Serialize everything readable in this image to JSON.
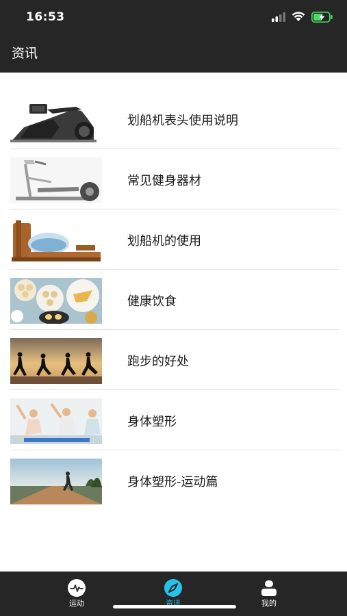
{
  "status_bar": {
    "time": "16:53"
  },
  "header": {
    "title": "资讯"
  },
  "articles": [
    {
      "title": "划船机表头使用说明",
      "thumbnail": "rowing-machine-monitor-photo"
    },
    {
      "title": "常见健身器材",
      "thumbnail": "elliptical-trainer-photo"
    },
    {
      "title": "划船机的使用",
      "thumbnail": "water-rower-photo"
    },
    {
      "title": "健康饮食",
      "thumbnail": "healthy-food-photo"
    },
    {
      "title": "跑步的好处",
      "thumbnail": "runners-sunset-photo"
    },
    {
      "title": "身体塑形",
      "thumbnail": "yoga-class-photo"
    },
    {
      "title": "身体塑形-运动篇",
      "thumbnail": "runner-road-photo"
    }
  ],
  "tabbar": {
    "tabs": [
      {
        "label": "运动",
        "icon": "activity-pulse-icon",
        "active": false
      },
      {
        "label": "资讯",
        "icon": "compass-icon",
        "active": true
      },
      {
        "label": "我的",
        "icon": "user-profile-icon",
        "active": false
      }
    ]
  },
  "colors": {
    "bar_background": "#262626",
    "accent": "#25c3ec",
    "battery_green": "#4cd964"
  }
}
